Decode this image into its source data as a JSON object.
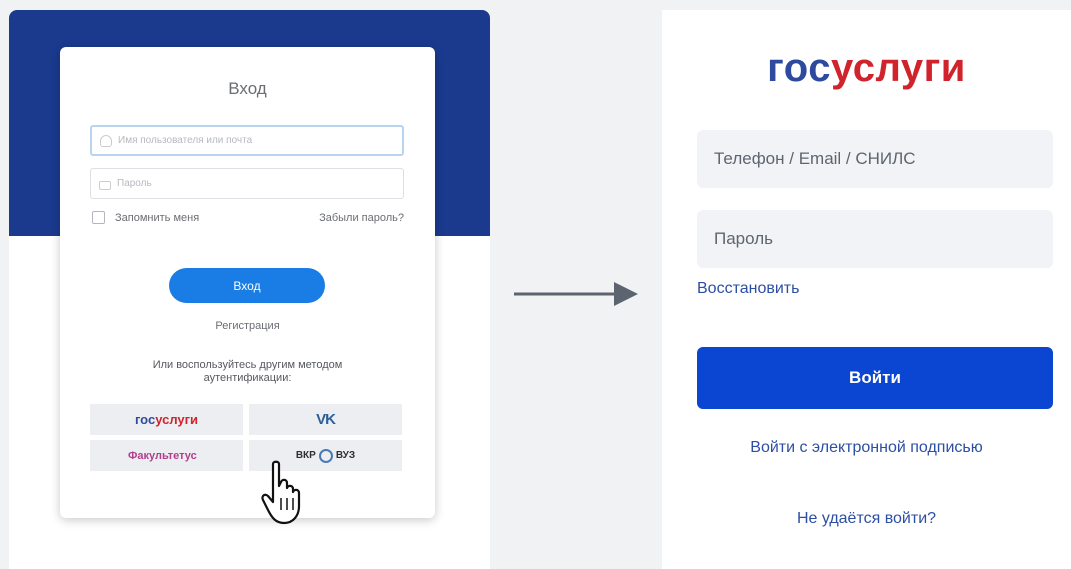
{
  "left_form": {
    "title": "Вход",
    "username_placeholder": "Имя пользователя или почта",
    "password_placeholder": "Пароль",
    "remember_label": "Запомнить меня",
    "forgot_label": "Забыли пароль?",
    "login_button": "Вход",
    "register_link": "Регистрация",
    "alt_methods_text": "Или воспользуйтесь другим методом аутентификации:",
    "alt_providers": {
      "gosuslugi_part1": "гос",
      "gosuslugi_part2": "услуги",
      "vk": "VK",
      "fakultetus": "Факультетус",
      "vkr_part1": "ВКР",
      "vkr_part2": "ВУЗ"
    },
    "colors": {
      "band": "#1b3a8e",
      "button": "#1a7de5"
    }
  },
  "right_form": {
    "logo_part1": "гос",
    "logo_part2": "услуги",
    "login_placeholder": "Телефон / Email / СНИЛС",
    "password_placeholder": "Пароль",
    "restore_link": "Восстановить",
    "login_button": "Войти",
    "esign_link": "Войти с электронной подписью",
    "cant_login_link": "Не удаётся войти?",
    "colors": {
      "logo_blue": "#2e4a9e",
      "logo_red": "#d0232b",
      "button": "#0a46d2",
      "link": "#2c4fa3"
    }
  },
  "icons": [
    "user-icon",
    "lock-icon",
    "hand-cursor-icon",
    "arrow-right-icon",
    "vkr-emblem-icon"
  ]
}
